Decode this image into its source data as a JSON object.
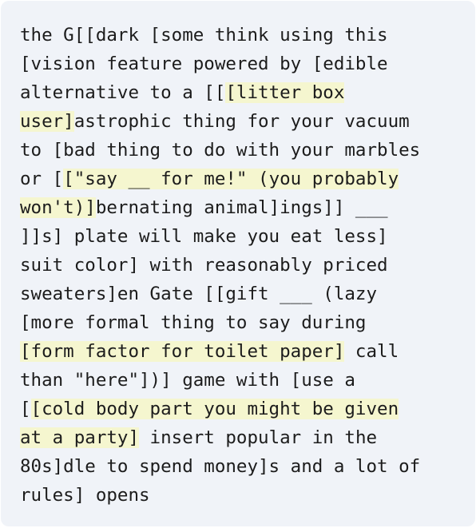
{
  "text_lines": [
    [
      {
        "t": "the G[[dark [some think using this"
      }
    ],
    [
      {
        "t": "[vision feature powered by [edible"
      }
    ],
    [
      {
        "t": "alternative to a [["
      },
      {
        "t": "[litter box",
        "hl": true
      }
    ],
    [
      {
        "t": "user]",
        "hl": true
      },
      {
        "t": "astrophic thing for your vacuum"
      }
    ],
    [
      {
        "t": "to [bad thing to do with your marbles"
      }
    ],
    [
      {
        "t": "or ["
      },
      {
        "t": "[\"say __ for me!\" (you probably",
        "hl": true
      }
    ],
    [
      {
        "t": "won't)]",
        "hl": true
      },
      {
        "t": "bernating animal]ings]] ___"
      }
    ],
    [
      {
        "t": "]]s] plate will make you eat less]"
      }
    ],
    [
      {
        "t": "suit color] with reasonably priced"
      }
    ],
    [
      {
        "t": "sweaters]en Gate [[gift ___ (lazy"
      }
    ],
    [
      {
        "t": "[more formal thing to say during"
      }
    ],
    [
      {
        "t": "[form factor for toilet paper]",
        "hl": true
      },
      {
        "t": " call"
      }
    ],
    [
      {
        "t": "than \"here\"])] game with [use a"
      }
    ],
    [
      {
        "t": "["
      },
      {
        "t": "[cold body part you might be given",
        "hl": true
      }
    ],
    [
      {
        "t": "at a party]",
        "hl": true
      },
      {
        "t": " insert popular in the"
      }
    ],
    [
      {
        "t": "80s]dle to spend money]s and a lot of"
      }
    ],
    [
      {
        "t": "rules] opens"
      }
    ]
  ],
  "colors": {
    "card_background": "#f0f3f8",
    "highlight": "#f5f6cf",
    "text": "#1c1c1c"
  }
}
